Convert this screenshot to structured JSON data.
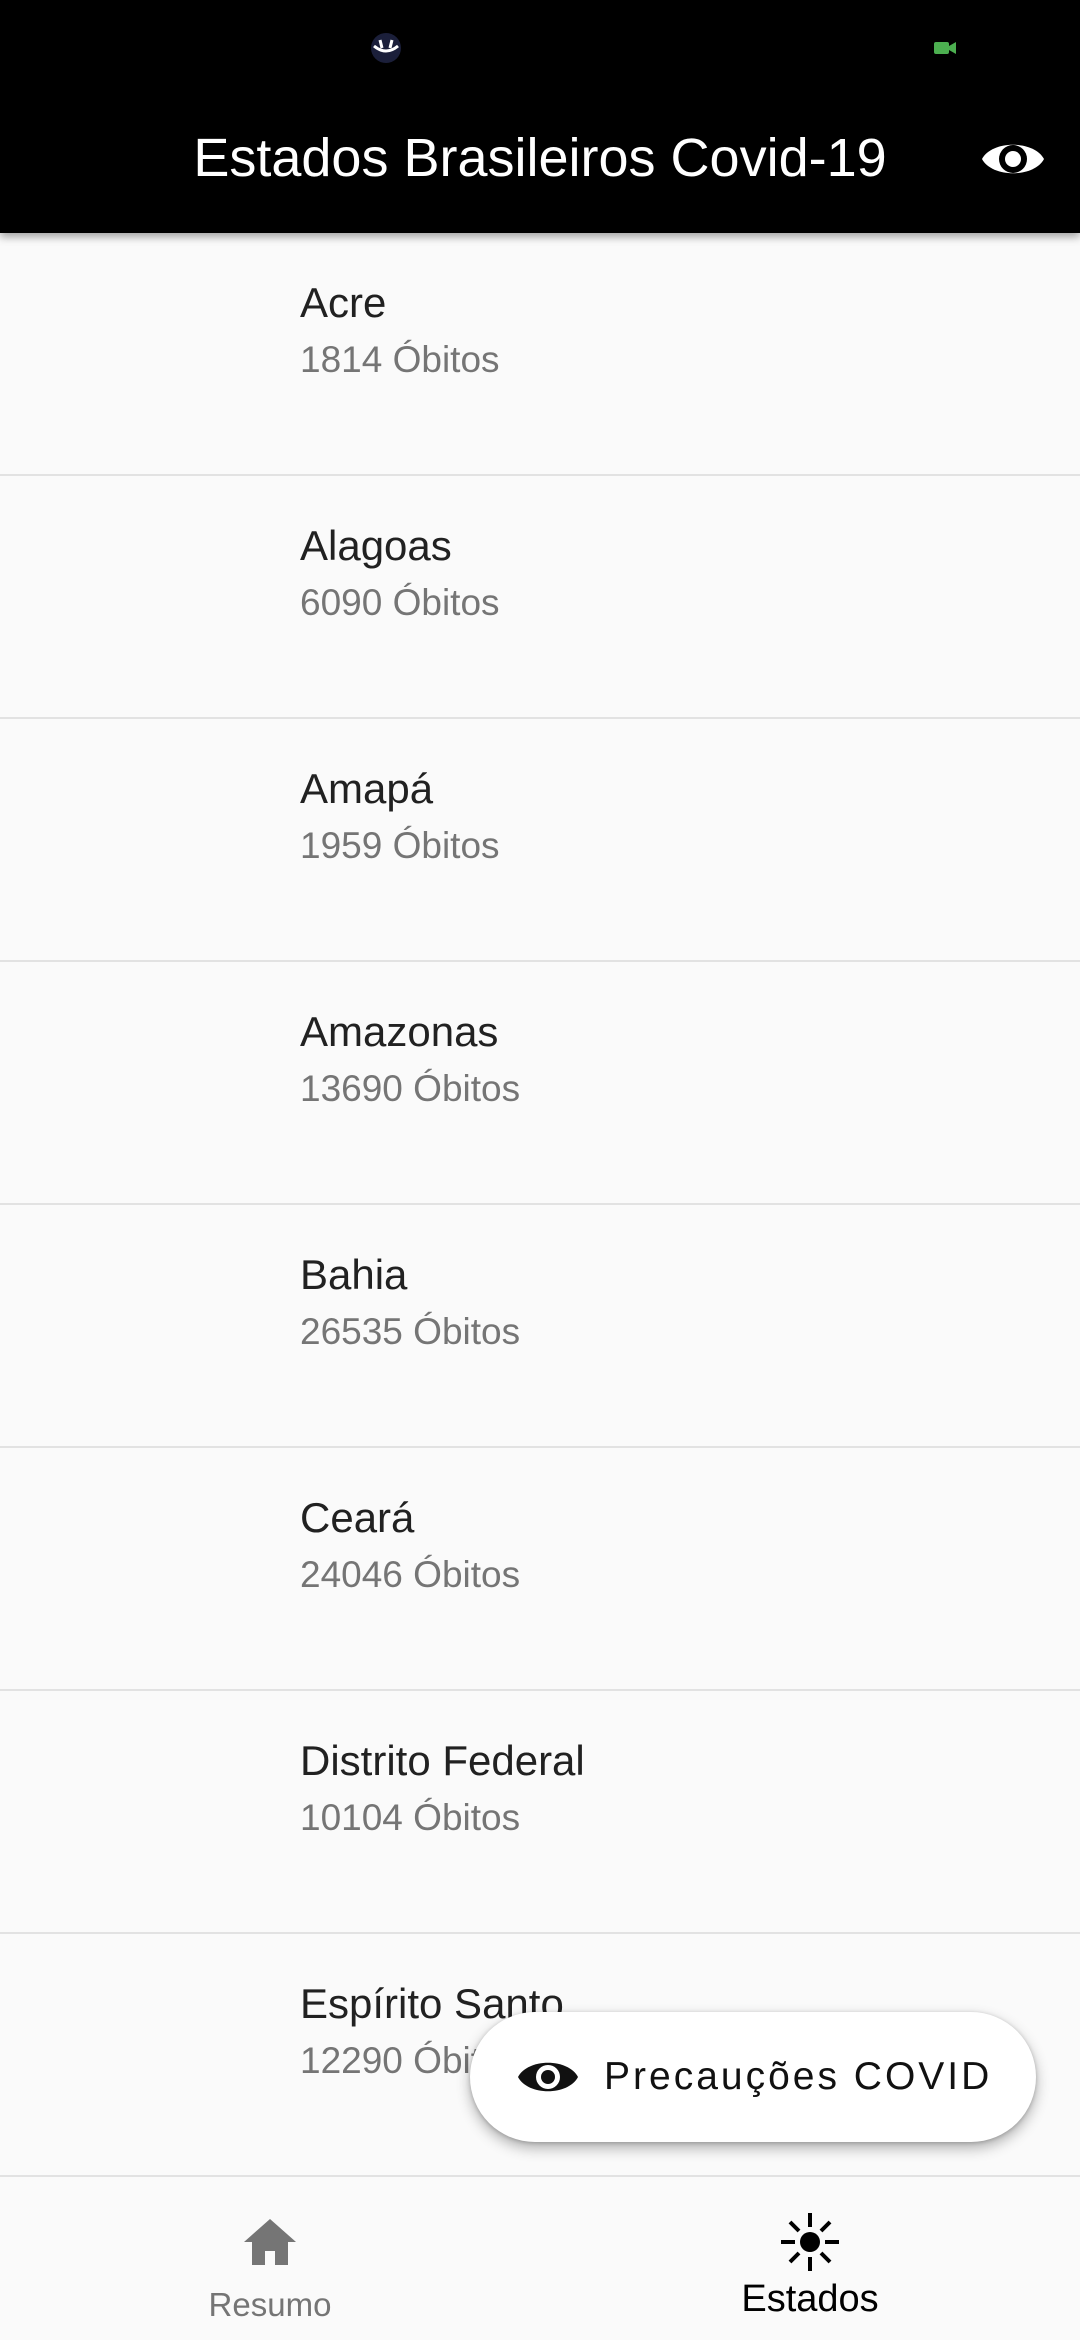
{
  "header": {
    "title": "Estados Brasileiros Covid-19",
    "action_icon": "eye-icon",
    "background": "#000000"
  },
  "states": [
    {
      "name": "Acre",
      "deaths": "1814 Óbitos"
    },
    {
      "name": "Alagoas",
      "deaths": "6090 Óbitos"
    },
    {
      "name": "Amapá",
      "deaths": "1959 Óbitos"
    },
    {
      "name": "Amazonas",
      "deaths": "13690 Óbitos"
    },
    {
      "name": "Bahia",
      "deaths": "26535 Óbitos"
    },
    {
      "name": "Ceará",
      "deaths": "24046 Óbitos"
    },
    {
      "name": "Distrito Federal",
      "deaths": "10104 Óbitos"
    },
    {
      "name": "Espírito Santo",
      "deaths": "12290 Óbitos"
    }
  ],
  "fab": {
    "label": "Precauções COVID",
    "icon": "eye-icon"
  },
  "bottom_nav": {
    "items": [
      {
        "label": "Resumo",
        "icon": "home-icon",
        "active": false
      },
      {
        "label": "Estados",
        "icon": "virus-icon",
        "active": true
      }
    ],
    "active_color": "#000000",
    "inactive_color": "#757575"
  }
}
